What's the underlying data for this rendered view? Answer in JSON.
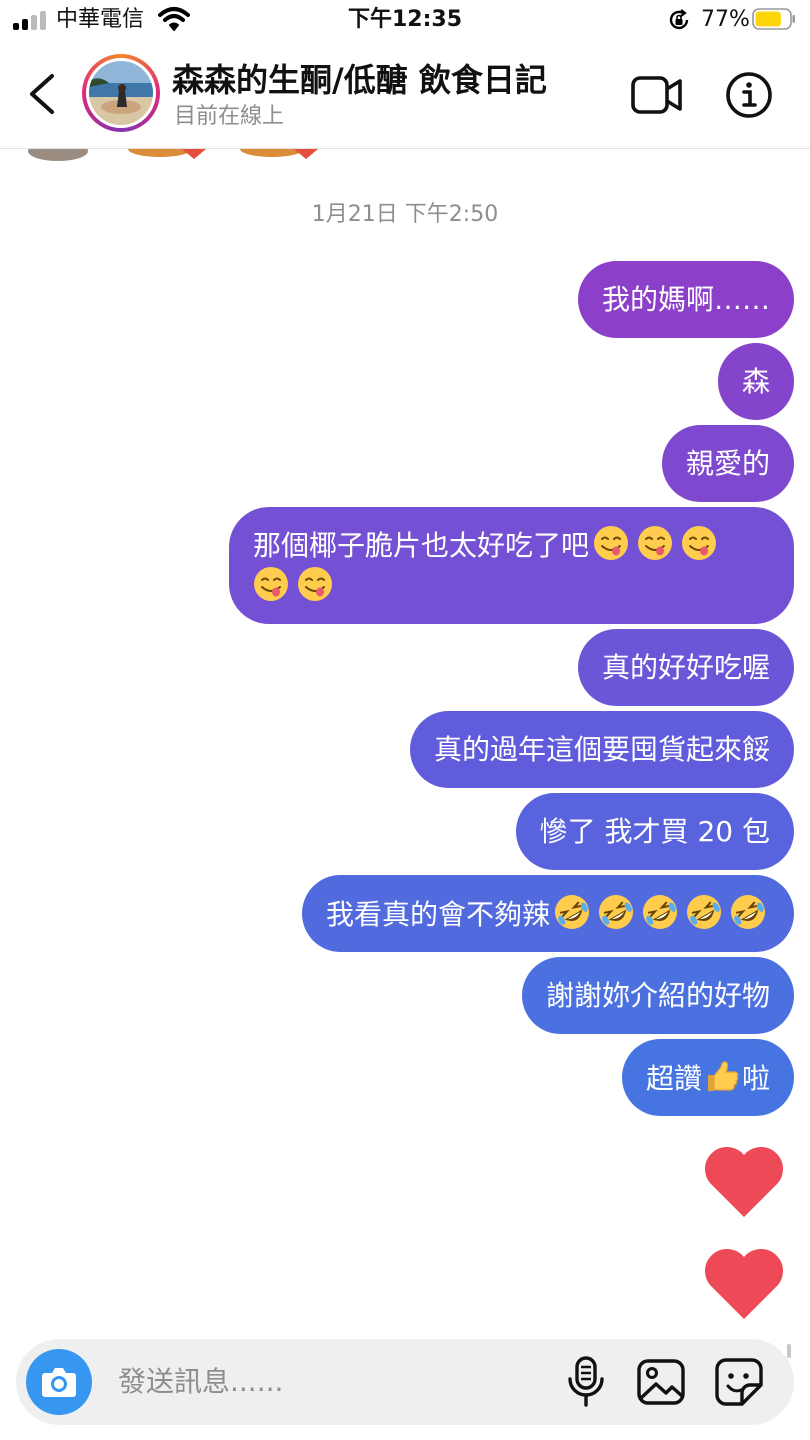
{
  "status_bar": {
    "carrier": "中華電信",
    "time": "下午12:35",
    "battery_percent": "77%",
    "battery_level": 0.77,
    "battery_color": "#ffd60a"
  },
  "header": {
    "title": "森森的生酮/低醣 飲食日記",
    "subtitle": "目前在線上",
    "icons": [
      "back-chevron-icon",
      "video-call-icon",
      "info-icon"
    ]
  },
  "chat": {
    "date_separator": "1月21日 下午2:50",
    "messages": [
      {
        "text": "我的媽啊……",
        "color": "#8c3fc9"
      },
      {
        "text": "森",
        "color": "#8544cc"
      },
      {
        "text": "親愛的",
        "color": "#7e48cf"
      },
      {
        "text": "那個椰子脆片也太好吃了吧",
        "emoji": [
          "yum-emoji",
          "yum-emoji",
          "yum-emoji",
          "yum-emoji",
          "yum-emoji"
        ],
        "color": "#7451d4"
      },
      {
        "text": "真的好好吃喔",
        "color": "#6957d8"
      },
      {
        "text": "真的過年這個要囤貨起來餒",
        "color": "#605cdb"
      },
      {
        "text": "慘了 我才買 20 包",
        "color": "#5963dd"
      },
      {
        "text": "我看真的會不夠辣",
        "emoji": [
          "rofl-emoji",
          "rofl-emoji",
          "rofl-emoji",
          "rofl-emoji",
          "rofl-emoji"
        ],
        "color": "#516ade"
      },
      {
        "text": "謝謝妳介紹的好物",
        "color": "#4b70e0"
      },
      {
        "text": "超讚",
        "emoji": [
          "thumbs-up-emoji"
        ],
        "text_after": "啦",
        "color": "#4674e1"
      }
    ],
    "reactions": [
      "heart-icon",
      "heart-icon"
    ],
    "heart_color": "#ed4956"
  },
  "composer": {
    "placeholder": "發送訊息......",
    "camera_button_color": "#3797f0",
    "icons": [
      "camera-icon",
      "microphone-icon",
      "gallery-icon",
      "sticker-icon"
    ]
  }
}
